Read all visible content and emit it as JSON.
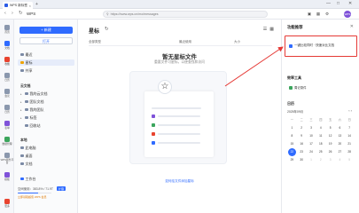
{
  "browser": {
    "tab_title": "WPS 新标签",
    "new_tab": "+",
    "url": "https://www.wps.cn/mo/messages",
    "window_controls": [
      "—",
      "□",
      "✕"
    ],
    "avatar": "WPS"
  },
  "rail": [
    {
      "label": "首页",
      "icon": "home-icon"
    },
    {
      "label": "文档",
      "icon": "document-icon",
      "active": true
    },
    {
      "label": "收藏",
      "icon": "star-icon"
    },
    {
      "label": "日历",
      "icon": "calendar-icon"
    },
    {
      "label": "会议",
      "icon": "meeting-icon"
    },
    {
      "label": "日历",
      "icon": "schedule-icon"
    },
    {
      "label": "表单",
      "icon": "form-icon"
    },
    {
      "label": "数据管理",
      "icon": "data-icon"
    },
    {
      "label": "WPS服务平台",
      "icon": "platform-icon"
    },
    {
      "label": "模板",
      "icon": "template-icon"
    },
    {
      "label": "更多",
      "icon": "more-icon"
    }
  ],
  "sidebar": {
    "new_label": "+ 新建",
    "open_label": "打开",
    "items": [
      {
        "label": "最近",
        "icon": "recent-icon"
      },
      {
        "label": "星标",
        "icon": "star-icon",
        "active": true
      },
      {
        "label": "共享",
        "icon": "share-icon"
      }
    ],
    "section1": "云文档",
    "cloud_items": [
      {
        "label": "我的云文档"
      },
      {
        "label": "团队文档"
      },
      {
        "label": "我的团队"
      },
      {
        "label": "标签"
      },
      {
        "label": "回收站"
      }
    ],
    "section2": "本地",
    "local_items": [
      {
        "label": "此电脑"
      },
      {
        "label": "桌面"
      },
      {
        "label": "文档"
      }
    ],
    "workspace": "工作台",
    "storage_text": "空间使用：383.8% / 71.9T",
    "storage_fraction": 0.6,
    "expand_label": "扩容",
    "promo": "立即领取超值 WPS 会员"
  },
  "main": {
    "title": "星标",
    "refresh_icon": "refresh-icon",
    "columns": [
      "全部类型",
      "最近使用",
      "大小"
    ],
    "empty_title": "暂无星标文件",
    "empty_sub": "重要文件可星标，以便查找和访问",
    "link": "如何给文件添加星标"
  },
  "right_panel": {
    "title": "功能推荐",
    "close": "✕",
    "highlight_item": "一键比较同时 · 快速对比文档",
    "tools_title": "效率工具",
    "tool_item": "周记录件",
    "cal_title": "日历",
    "cal_month": "2025年09月",
    "cal_controls": "‹ ›",
    "weekdays": [
      "一",
      "二",
      "三",
      "四",
      "五",
      "六",
      "日"
    ],
    "weeks": [
      [
        "1",
        "2",
        "3",
        "4",
        "5",
        "6",
        "7"
      ],
      [
        "8",
        "9",
        "10",
        "11",
        "12",
        "13",
        "14"
      ],
      [
        "15",
        "16",
        "17",
        "18",
        "19",
        "20",
        "21"
      ],
      [
        "22",
        "23",
        "24",
        "25",
        "26",
        "27",
        "28"
      ],
      [
        "29",
        "30",
        "1",
        "2",
        "3",
        "4",
        "5"
      ]
    ],
    "today": "22"
  },
  "colors": {
    "accent": "#2f6bff",
    "highlight": "#e53935"
  }
}
